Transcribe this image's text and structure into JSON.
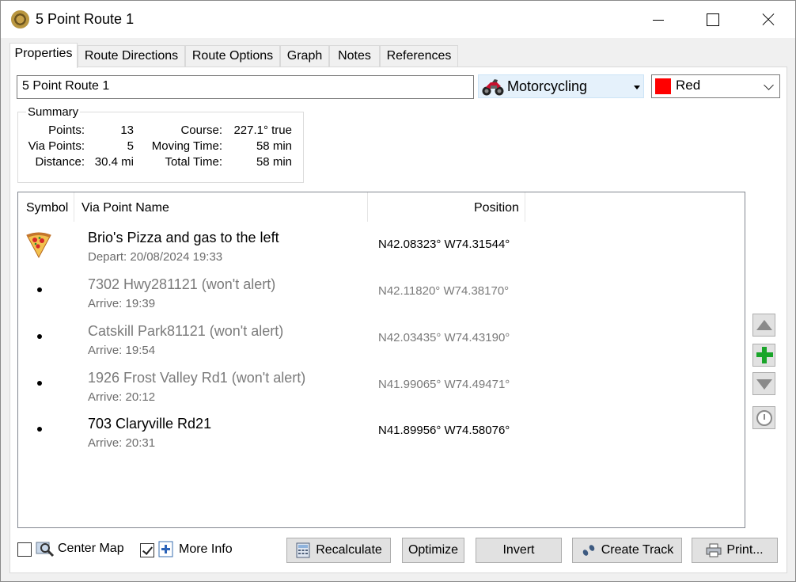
{
  "window": {
    "title": "5 Point Route 1"
  },
  "tabs": [
    {
      "label": "Properties",
      "active": true
    },
    {
      "label": "Route Directions"
    },
    {
      "label": "Route Options"
    },
    {
      "label": "Graph"
    },
    {
      "label": "Notes"
    },
    {
      "label": "References"
    }
  ],
  "route": {
    "name": "5 Point Route 1",
    "mode": "Motorcycling",
    "color_name": "Red",
    "color_hex": "#ff0000"
  },
  "summary": {
    "legend": "Summary",
    "points_label": "Points:",
    "points_value": "13",
    "via_label": "Via Points:",
    "via_value": "5",
    "distance_label": "Distance:",
    "distance_value": "30.4 mi",
    "course_label": "Course:",
    "course_value": "227.1° true",
    "moving_label": "Moving Time:",
    "moving_value": "58 min",
    "total_label": "Total Time:",
    "total_value": "58 min"
  },
  "list": {
    "columns": {
      "symbol": "Symbol",
      "name": "Via Point Name",
      "position": "Position"
    },
    "rows": [
      {
        "symbol": "pizza-icon",
        "name": "Brio's Pizza and gas to the left",
        "time": "Depart: 20/08/2024 19:33",
        "position": "N42.08323° W74.31544°",
        "alerts": true
      },
      {
        "symbol": "bullet",
        "name": "7302 Hwy281121 (won't alert)",
        "time": "Arrive: 19:39",
        "position": "N42.11820° W74.38170°",
        "alerts": false
      },
      {
        "symbol": "bullet",
        "name": "Catskill Park81121 (won't alert)",
        "time": "Arrive: 19:54",
        "position": "N42.03435° W74.43190°",
        "alerts": false
      },
      {
        "symbol": "bullet",
        "name": "1926 Frost Valley Rd1 (won't alert)",
        "time": "Arrive: 20:12",
        "position": "N41.99065° W74.49471°",
        "alerts": false
      },
      {
        "symbol": "bullet",
        "name": "703 Claryville Rd21",
        "time": "Arrive: 20:31",
        "position": "N41.89956° W74.58076°",
        "alerts": true
      }
    ]
  },
  "bottom": {
    "center_map_label": "Center Map",
    "center_map_checked": false,
    "more_info_label": "More Info",
    "more_info_checked": true,
    "recalculate_label": "Recalculate",
    "optimize_label": "Optimize",
    "invert_label": "Invert",
    "create_track_label": "Create Track",
    "print_label": "Print..."
  },
  "colors": {
    "accent_blue": "#e5f1fb",
    "add_green": "#1aa52a",
    "dim_text": "#7a7a7a"
  }
}
